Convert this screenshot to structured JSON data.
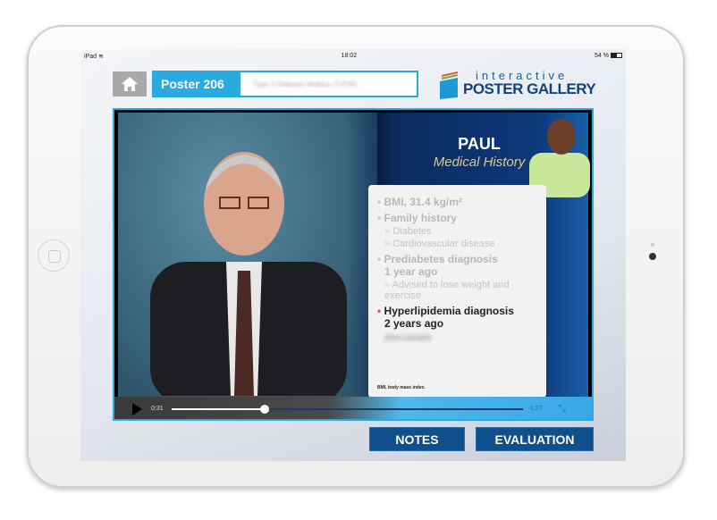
{
  "status_bar": {
    "device": "iPad",
    "time": "18:02",
    "battery": "54 %",
    "battery_level": 0.54
  },
  "header": {
    "poster_number": "Poster 206",
    "poster_title": "Type 2 Diabetes Mellitus (T2DM)",
    "logo_line1": "interactive",
    "logo_line2": "POSTER GALLERY"
  },
  "video": {
    "patient_name": "PAUL",
    "section_title": "Medical History",
    "items": [
      {
        "label": "BMI, 31.4 kg/m²"
      },
      {
        "label": "Family history",
        "sub": [
          "Diabetes",
          "Cardiovascular disease"
        ]
      },
      {
        "label": "Prediabetes diagnosis",
        "line2": "1 year ago",
        "sub": [
          "Advised to lose weight and exercise"
        ]
      },
      {
        "label": "Hyperlipidemia diagnosis",
        "line2": "2 years ago",
        "sub": [
          "Atorvastatin"
        ]
      }
    ],
    "footnote": "BMI, body mass index.",
    "elapsed": "0:31",
    "remaining": "-1:27",
    "progress": 0.265
  },
  "buttons": {
    "notes": "NOTES",
    "evaluation": "EVALUATION"
  },
  "colors": {
    "accent": "#29abe2",
    "button": "#0f4f8c"
  }
}
